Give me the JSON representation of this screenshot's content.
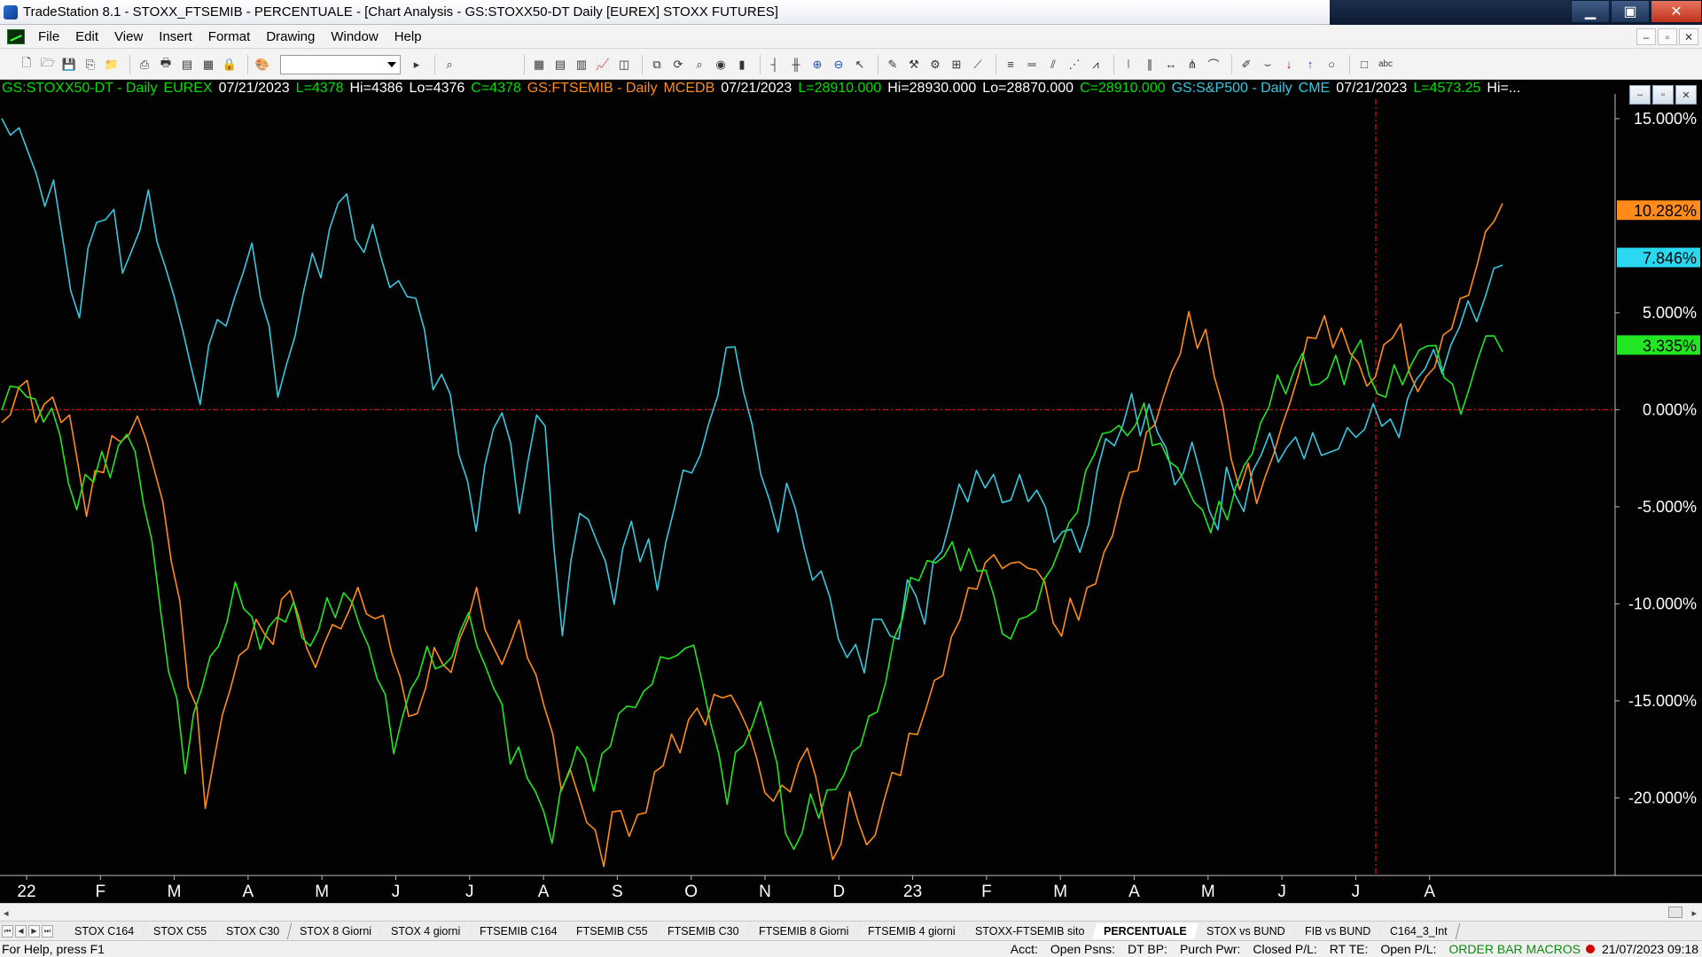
{
  "window": {
    "title": "TradeStation 8.1 - STOXX_FTSEMIB - PERCENTUALE - [Chart Analysis - GS:STOXX50-DT  Daily  [EUREX] STOXX FUTURES]",
    "min_glyph": "▁",
    "max_glyph": "▣",
    "close_glyph": "✕"
  },
  "menu": {
    "items": [
      "File",
      "Edit",
      "View",
      "Insert",
      "Format",
      "Drawing",
      "Window",
      "Help"
    ],
    "mdi_min": "–",
    "mdi_restore": "▫",
    "mdi_close": "✕"
  },
  "toolbar": {
    "icons": [
      "new-icon",
      "open-icon",
      "save-icon",
      "copy-icon",
      "folder-icon",
      "print-icon",
      "print-preview-icon",
      "window-icon",
      "tile-icon",
      "lock-icon",
      "palette-icon"
    ],
    "symbol_value": "",
    "icons_right": [
      "grid-icon",
      "format-icon",
      "table-icon",
      "chart-icon",
      "layout-icon",
      "workspace-icon",
      "refresh-icon",
      "scan-icon",
      "radar-icon",
      "candle-icon",
      "bar-icon",
      "ohlc-icon",
      "zoom-in-icon",
      "zoom-out-icon",
      "pointer-icon",
      "drawing-icon",
      "tools-icon",
      "strategy-icon",
      "options-icon",
      "trendline-icon",
      "fibonacci-icon",
      "hline-icon",
      "channel-icon",
      "gann-icon",
      "speedline-icon",
      "cycle-icon",
      "regression-icon",
      "arrow-icon",
      "pitchfork-icon",
      "arc-icon",
      "pen-icon",
      "curve-icon",
      "sell-arrow-icon",
      "buy-arrow-icon",
      "ellipse-icon",
      "rectangle-icon",
      "text-icon"
    ],
    "glyphs": {
      "new-icon": "🗋",
      "open-icon": "🗁",
      "save-icon": "💾",
      "copy-icon": "⎘",
      "folder-icon": "📁",
      "print-icon": "⎙",
      "print-preview-icon": "🖶",
      "window-icon": "▤",
      "tile-icon": "▦",
      "lock-icon": "🔒",
      "palette-icon": "🎨",
      "grid-icon": "▦",
      "format-icon": "▤",
      "table-icon": "▥",
      "chart-icon": "📈",
      "layout-icon": "◫",
      "workspace-icon": "⧉",
      "refresh-icon": "⟳",
      "scan-icon": "⌕",
      "radar-icon": "◉",
      "candle-icon": "▮",
      "bar-icon": "┤",
      "ohlc-icon": "╫",
      "zoom-in-icon": "⊕",
      "zoom-out-icon": "⊖",
      "pointer-icon": "↖",
      "drawing-icon": "✎",
      "tools-icon": "⚒",
      "strategy-icon": "⚙",
      "options-icon": "⊞",
      "trendline-icon": "⟋",
      "fibonacci-icon": "≡",
      "hline-icon": "═",
      "channel-icon": "⫽",
      "gann-icon": "⋰",
      "speedline-icon": "⩘",
      "cycle-icon": "⦚",
      "regression-icon": "∥",
      "arrow-icon": "↔",
      "pitchfork-icon": "⋔",
      "arc-icon": "⌒",
      "pen-icon": "✐",
      "curve-icon": "⌣",
      "sell-arrow-icon": "↓",
      "buy-arrow-icon": "↑",
      "ellipse-icon": "○",
      "rectangle-icon": "□",
      "text-icon": "abc"
    }
  },
  "legend": [
    {
      "text": "GS:STOXX50-DT - Daily",
      "color": "#00e000"
    },
    {
      "text": "EUREX",
      "color": "#00e000"
    },
    {
      "text": "07/21/2023",
      "color": "#ffffff"
    },
    {
      "text": "L=4378",
      "color": "#00e000"
    },
    {
      "text": "Hi=4386",
      "color": "#ffffff"
    },
    {
      "text": "Lo=4376",
      "color": "#ffffff"
    },
    {
      "text": "C=4378",
      "color": "#00e000"
    },
    {
      "text": "GS:FTSEMIB - Daily",
      "color": "#ff8c1a"
    },
    {
      "text": "MCEDB",
      "color": "#ff8c1a"
    },
    {
      "text": "07/21/2023",
      "color": "#ffffff"
    },
    {
      "text": "L=28910.000",
      "color": "#00e000"
    },
    {
      "text": "Hi=28930.000",
      "color": "#ffffff"
    },
    {
      "text": "Lo=28870.000",
      "color": "#ffffff"
    },
    {
      "text": "C=28910.000",
      "color": "#00e000"
    },
    {
      "text": "GS:S&P500 - Daily",
      "color": "#38c8e0"
    },
    {
      "text": "CME",
      "color": "#38c8e0"
    },
    {
      "text": "07/21/2023",
      "color": "#ffffff"
    },
    {
      "text": "L=4573.25",
      "color": "#00e000"
    },
    {
      "text": "Hi=...",
      "color": "#ffffff"
    }
  ],
  "chart_data": {
    "type": "line",
    "y_unit": "%",
    "ylim": [
      -24.0,
      16.0
    ],
    "y_ticks": [
      {
        "value": 15,
        "label": "15.000%"
      },
      {
        "value": 5,
        "label": "5.000%"
      },
      {
        "value": 0,
        "label": "0.000%"
      },
      {
        "value": -5,
        "label": "-5.000%"
      },
      {
        "value": -10,
        "label": "-10.000%"
      },
      {
        "value": -15,
        "label": "-15.000%"
      },
      {
        "value": -20,
        "label": "-20.000%"
      }
    ],
    "x_ticks": [
      "22",
      "F",
      "M",
      "A",
      "M",
      "J",
      "J",
      "A",
      "S",
      "O",
      "N",
      "D",
      "23",
      "F",
      "M",
      "A",
      "M",
      "J",
      "J",
      "A"
    ],
    "zero_line": 0,
    "last_value_tags": [
      {
        "series": "GS:FTSEMIB",
        "label": "10.282%",
        "value": 10.282,
        "bg": "#ff8c1a"
      },
      {
        "series": "GS:S&P500",
        "label": "7.846%",
        "value": 7.846,
        "bg": "#2ad8f0"
      },
      {
        "series": "GS:STOXX50-DT",
        "label": "3.335%",
        "value": 3.335,
        "bg": "#22e622"
      }
    ],
    "series": [
      {
        "name": "GS:S&P500",
        "color": "#38c8e0",
        "values": [
          15,
          14,
          14.8,
          13,
          12.5,
          10.2,
          12,
          9,
          6,
          5,
          8,
          10,
          9.5,
          10.5,
          7,
          8,
          9.5,
          11,
          9,
          7,
          6,
          4,
          2,
          0.5,
          3,
          5,
          4,
          6,
          7,
          8.5,
          6,
          4,
          1,
          2,
          4,
          6,
          8,
          7,
          9,
          11,
          10.8,
          9,
          8,
          9.5,
          8,
          6,
          7,
          5.5,
          6,
          4,
          1,
          2,
          0.5,
          -2,
          -4,
          -6,
          -3,
          -1,
          0,
          -2,
          -5,
          -3,
          0,
          -1,
          -7,
          -11.5,
          -8,
          -5,
          -6,
          -6.5,
          -8,
          -10,
          -7,
          -6,
          -7.5,
          -7,
          -9,
          -7,
          -5,
          -3,
          -3.5,
          -2,
          -1,
          1,
          3,
          3.3,
          1,
          -1,
          -3,
          -5,
          -6,
          -4,
          -5,
          -7,
          -9,
          -8,
          -10,
          -11.5,
          -13,
          -12,
          -13.5,
          -11,
          -10.5,
          -12,
          -11.5,
          -9,
          -9.5,
          -11,
          -8,
          -7,
          -6,
          -3.5,
          -5,
          -3,
          -4,
          -3.5,
          -4.5,
          -5,
          -3,
          -5,
          -4,
          -5,
          -7,
          -6,
          -6.5,
          -7,
          -6.2,
          -3,
          -1.5,
          -2,
          -0.5,
          0.5,
          -1,
          0,
          -1,
          -2,
          -4,
          -3,
          -2,
          -3,
          -5.5,
          -6,
          -3,
          -4.5,
          -5,
          -3.5,
          -2,
          -1.5,
          -2.5,
          -2,
          -1.5,
          -2.3,
          -1.5,
          -2,
          -2.5,
          -1.8,
          -1,
          -1.5,
          -0.8,
          0,
          -0.5,
          -0.8,
          -1.2,
          0.5,
          1.5,
          2.3,
          2.8,
          2.2,
          3,
          4.5,
          5.5,
          4.5,
          6,
          7,
          7.8
        ]
      },
      {
        "name": "GS:FTSEMIB",
        "color": "#ff8c1a",
        "values": [
          -1,
          0,
          1,
          1.5,
          -0.5,
          0,
          1,
          -1,
          0,
          -3,
          -5.5,
          -3,
          -3.5,
          -1,
          -2,
          -1,
          -0.5,
          -1.5,
          -3,
          -5,
          -7.5,
          -10.2,
          -14,
          -15.5,
          -20.5,
          -18,
          -16,
          -14,
          -13,
          -12,
          -11,
          -11.5,
          -12,
          -10,
          -9,
          -11,
          -12,
          -13.5,
          -12,
          -11,
          -11.5,
          -10,
          -9.5,
          -10.2,
          -11,
          -10.5,
          -12.5,
          -14,
          -15.5,
          -16,
          -14,
          -12.5,
          -13,
          -13.5,
          -12,
          -10.5,
          -9.5,
          -11,
          -12.5,
          -13,
          -12,
          -11,
          -12.5,
          -14,
          -15,
          -17,
          -19.5,
          -18.5,
          -20,
          -21,
          -22,
          -23.2,
          -21,
          -20.5,
          -22,
          -21,
          -20.5,
          -19,
          -18,
          -17,
          -17.5,
          -16,
          -15.5,
          -16,
          -15,
          -14.5,
          -15,
          -15.3,
          -16.5,
          -18,
          -19.5,
          -20.5,
          -19,
          -20,
          -18,
          -17.5,
          -19,
          -21,
          -23.5,
          -22,
          -20,
          -21,
          -22.5,
          -22,
          -20,
          -19,
          -18.5,
          -17,
          -16.5,
          -15.5,
          -14,
          -13.5,
          -12,
          -10.5,
          -9.5,
          -9,
          -8,
          -7.5,
          -8,
          -8.2,
          -7.5,
          -8.5,
          -8,
          -9,
          -11,
          -11.5,
          -10,
          -10.5,
          -9.5,
          -8.7,
          -7.5,
          -6.5,
          -4.5,
          -3.5,
          -2.8,
          -1.5,
          -0.5,
          0.5,
          2,
          3,
          4.8,
          3.5,
          3.8,
          2,
          0,
          -2.5,
          -4,
          -3,
          -4.5,
          -3.8,
          -2,
          -1,
          0.5,
          2,
          3.5,
          4,
          4.5,
          3.5,
          4,
          3,
          2.5,
          1,
          2,
          3,
          4,
          4.2,
          2,
          1,
          1.5,
          2.5,
          3.5,
          4.5,
          5.5,
          6,
          7.5,
          9,
          10,
          10.282
        ]
      },
      {
        "name": "GS:STOXX50-DT",
        "color": "#22e622",
        "values": [
          -0.2,
          1.5,
          0.8,
          1,
          0.3,
          -0.5,
          0.1,
          -1.5,
          -3.5,
          -5.5,
          -3,
          -4,
          -2,
          -3.5,
          -2,
          -1,
          -2.5,
          -4.5,
          -7,
          -10,
          -13.5,
          -15,
          -18.5,
          -16,
          -14,
          -13,
          -12,
          -11,
          -9,
          -10,
          -11,
          -12,
          -11.5,
          -10.5,
          -11,
          -10,
          -11.5,
          -12.5,
          -11,
          -10,
          -10.5,
          -9.5,
          -10,
          -11,
          -12.5,
          -13.5,
          -15,
          -17.5,
          -16,
          -14.5,
          -13.5,
          -12.5,
          -13,
          -13.5,
          -12.5,
          -11.5,
          -10.5,
          -12,
          -13.5,
          -14,
          -15.5,
          -18,
          -17.5,
          -19,
          -19.5,
          -21,
          -22,
          -20,
          -18.5,
          -17.5,
          -18,
          -19.5,
          -18,
          -17,
          -16,
          -15,
          -15.5,
          -14.5,
          -14,
          -13,
          -12.5,
          -13,
          -12,
          -12.3,
          -14,
          -16,
          -18,
          -20,
          -18,
          -17,
          -16.5,
          -15,
          -16.5,
          -18.5,
          -21.5,
          -23,
          -21.5,
          -20,
          -21,
          -19.5,
          -19.8,
          -18.5,
          -18,
          -17,
          -16,
          -15.5,
          -14,
          -12,
          -10.5,
          -9,
          -8.5,
          -8,
          -7.8,
          -7.5,
          -7,
          -8,
          -7.5,
          -8,
          -8.5,
          -9.5,
          -11.5,
          -12,
          -10.5,
          -11,
          -10,
          -9,
          -8,
          -7,
          -6,
          -5,
          -3.5,
          -2,
          -1.5,
          -1,
          -0.8,
          -1.5,
          -0.5,
          0,
          -1.5,
          -2,
          -2.5,
          -3,
          -4,
          -4.5,
          -5.5,
          -6,
          -5,
          -5.5,
          -4,
          -3,
          -2,
          -1,
          0.5,
          1.5,
          1,
          2,
          2.8,
          1.5,
          1,
          2,
          2.5,
          1.5,
          2.8,
          3.5,
          2,
          0.5,
          1,
          2,
          1.5,
          2.2,
          3,
          3.5,
          3,
          2,
          1,
          0,
          1,
          2.5,
          4,
          3.5,
          3.335
        ]
      }
    ]
  },
  "tabs": {
    "nav": [
      "⏮",
      "◀",
      "▶",
      "⏭"
    ],
    "items": [
      {
        "label": "STOX C164",
        "active": false
      },
      {
        "label": "STOX C55",
        "active": false
      },
      {
        "label": "STOX  C30",
        "active": false
      },
      {
        "label": "STOX  8 Giorni",
        "active": false
      },
      {
        "label": "STOX 4 giorni",
        "active": false
      },
      {
        "label": "FTSEMIB C164",
        "active": false
      },
      {
        "label": "FTSEMIB C55",
        "active": false
      },
      {
        "label": "FTSEMIB C30",
        "active": false
      },
      {
        "label": "FTSEMIB  8 Giorni",
        "active": false
      },
      {
        "label": "FTSEMIB  4 giorni",
        "active": false
      },
      {
        "label": "STOXX-FTSEMIB sito",
        "active": false
      },
      {
        "label": "PERCENTUALE",
        "active": true
      },
      {
        "label": "STOX vs BUND",
        "active": false
      },
      {
        "label": "FIB vs BUND",
        "active": false
      },
      {
        "label": "C164_3_Int",
        "active": false
      }
    ]
  },
  "status": {
    "help": "For Help, press F1",
    "acct": "Acct:",
    "open_psns": "Open Psns:",
    "dt_bp": "DT BP:",
    "purch_pwr": "Purch Pwr:",
    "closed_pl": "Closed P/L:",
    "rt_te": "RT TE:",
    "open_pl": "Open P/L:",
    "macros": "ORDER BAR  MACROS",
    "datetime": "21/07/2023 09:18"
  }
}
